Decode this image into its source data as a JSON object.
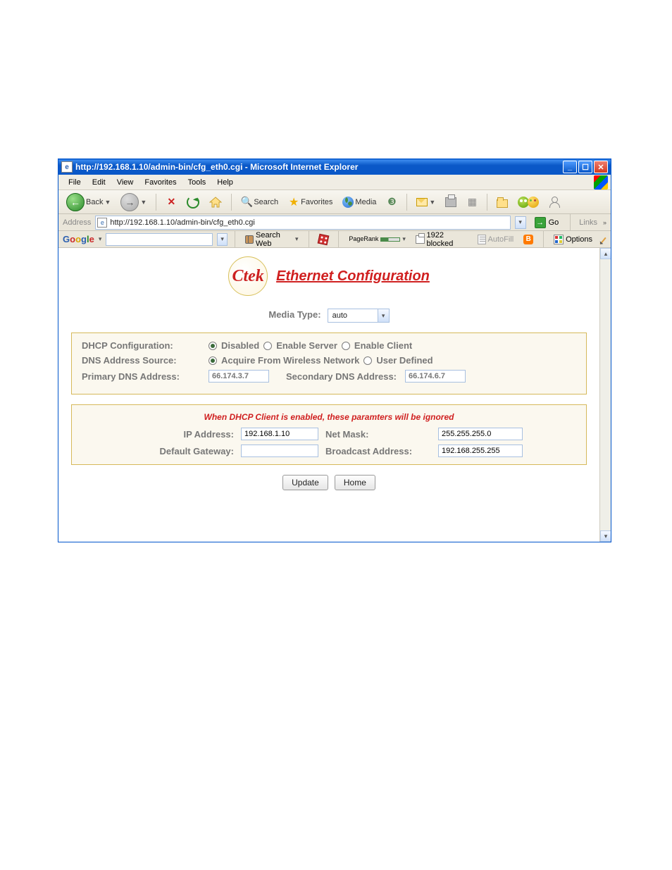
{
  "window": {
    "title": "http://192.168.1.10/admin-bin/cfg_eth0.cgi - Microsoft Internet Explorer"
  },
  "menubar": [
    "File",
    "Edit",
    "View",
    "Favorites",
    "Tools",
    "Help"
  ],
  "toolbar": {
    "back": "Back",
    "search": "Search",
    "favorites": "Favorites",
    "media": "Media"
  },
  "addressbar": {
    "label": "Address",
    "url": "http://192.168.1.10/admin-bin/cfg_eth0.cgi",
    "go": "Go",
    "links": "Links"
  },
  "googlebar": {
    "search_web": "Search Web",
    "pagerank": "PageRank",
    "blocked": "1922 blocked",
    "autofill": "AutoFill",
    "options": "Options"
  },
  "page": {
    "logo_text": "Ctek",
    "title": "Ethernet Configuration",
    "media_type_label": "Media Type:",
    "media_type_value": "auto",
    "panel1": {
      "dhcp_label": "DHCP Configuration:",
      "dhcp_opts": [
        "Disabled",
        "Enable Server",
        "Enable Client"
      ],
      "dhcp_selected": 0,
      "dns_src_label": "DNS Address Source:",
      "dns_src_opts": [
        "Acquire From Wireless Network",
        "User Defined"
      ],
      "dns_src_selected": 0,
      "primary_dns_label": "Primary DNS Address:",
      "primary_dns_value": "66.174.3.7",
      "secondary_dns_label": "Secondary DNS Address:",
      "secondary_dns_value": "66.174.6.7"
    },
    "panel2": {
      "hint": "When DHCP Client is enabled, these paramters will be ignored",
      "ip_label": "IP Address:",
      "ip_value": "192.168.1.10",
      "netmask_label": "Net Mask:",
      "netmask_value": "255.255.255.0",
      "gw_label": "Default Gateway:",
      "gw_value": "",
      "bcast_label": "Broadcast Address:",
      "bcast_value": "192.168.255.255"
    },
    "buttons": {
      "update": "Update",
      "home": "Home"
    }
  }
}
